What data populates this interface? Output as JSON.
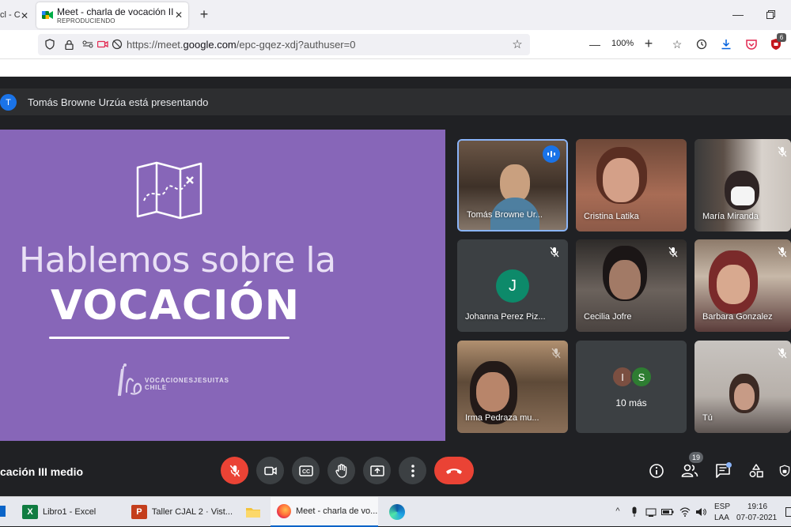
{
  "browser": {
    "inactive_tab_label": "cl - C",
    "active_tab": {
      "title": "Meet - charla de vocación III me",
      "subtitle": "REPRODUCIENDO"
    },
    "url_prefix": "https://meet.",
    "url_domain": "google.com",
    "url_path": "/epc-gqez-xdj?authuser=0",
    "zoom": "100%",
    "extension_badge": "6"
  },
  "meet": {
    "presenter_initial": "T",
    "presenting_text": "Tomás Browne Urzúa está presentando",
    "slide": {
      "line1": "Hablemos sobre la",
      "line2": "VOCACIÓN",
      "brand_line1": "VOCACIONESJESUITAS",
      "brand_line2": "CHILE"
    },
    "participants": [
      {
        "name": "Tomás Browne Ur..."
      },
      {
        "name": "Cristina Latika"
      },
      {
        "name": "María Miranda"
      },
      {
        "name": "Johanna Perez Piz...",
        "initial": "J"
      },
      {
        "name": "Cecilia Jofre"
      },
      {
        "name": "Barbara Gonzalez"
      },
      {
        "name": "Irma Pedraza mu..."
      },
      {
        "name": "10 más",
        "initials": [
          "I",
          "S"
        ]
      },
      {
        "name": "Tú"
      }
    ],
    "meeting_name": "cación III medio",
    "participant_count": "19",
    "colors": {
      "accent": "#1a73e8",
      "danger": "#ea4335",
      "slide_bg": "#8766b8"
    }
  },
  "taskbar": {
    "items": [
      {
        "label": "Libro1 - Excel"
      },
      {
        "label": "Taller CJAL 2 · Vist..."
      },
      {
        "label": "Meet - charla de vo..."
      }
    ],
    "lang_line1": "ESP",
    "lang_line2": "LAA",
    "time": "19:16",
    "date": "07-07-2021"
  }
}
